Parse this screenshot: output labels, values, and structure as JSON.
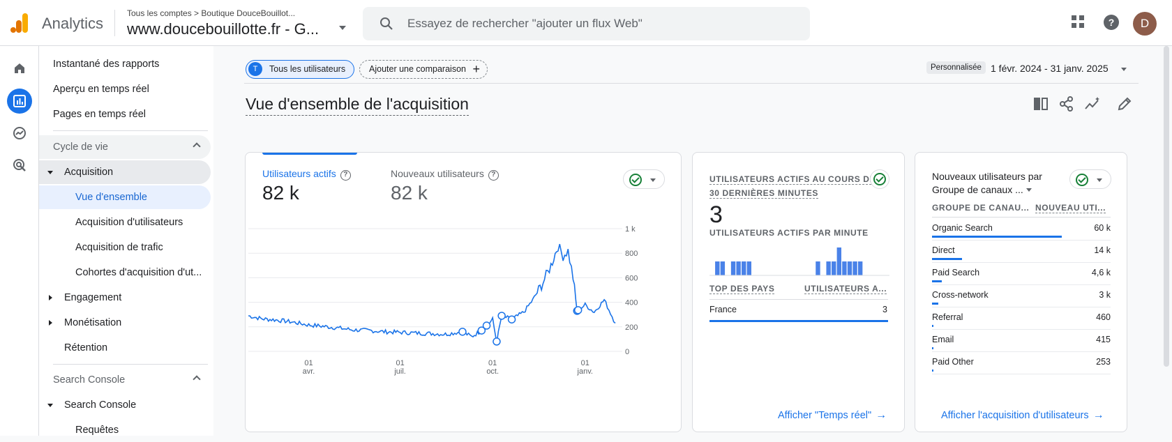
{
  "header": {
    "app_title": "Analytics",
    "breadcrumb": "Tous les comptes  >  Boutique DouceBouillot...",
    "property": "www.doucebouillotte.fr - G...",
    "search_placeholder": "Essayez de rechercher \"ajouter un flux Web\"",
    "avatar_letter": "D",
    "icons": [
      "apps-grid-icon",
      "help-icon"
    ]
  },
  "rail": {
    "icons": [
      "home-icon",
      "reports-icon",
      "explore-icon",
      "advertising-icon"
    ],
    "active": "reports-icon"
  },
  "nav": {
    "items": [
      {
        "label": "Instantané des rapports"
      },
      {
        "label": "Aperçu en temps réel"
      },
      {
        "label": "Pages en temps réel"
      },
      {
        "label": "Cycle de vie"
      },
      {
        "label": "Acquisition"
      },
      {
        "label": "Vue d'ensemble"
      },
      {
        "label": "Acquisition d'utilisateurs"
      },
      {
        "label": "Acquisition de trafic"
      },
      {
        "label": "Cohortes d'acquisition d'ut..."
      },
      {
        "label": "Engagement"
      },
      {
        "label": "Monétisation"
      },
      {
        "label": "Rétention"
      },
      {
        "label": "Search Console"
      },
      {
        "label": "Search Console"
      },
      {
        "label": "Requêtes"
      }
    ]
  },
  "toolbar": {
    "segment_chip": "Tous les utilisateurs",
    "segment_initial": "T",
    "compare_chip": "Ajouter une comparaison",
    "range_label": "Personnalisée",
    "range_value": "1 févr. 2024 - 31 janv. 2025",
    "page_title": "Vue d'ensemble de l'acquisition"
  },
  "card_users": {
    "tab1_label": "Utilisateurs actifs",
    "tab1_value": "82 k",
    "tab2_label": "Nouveaux utilisateurs",
    "tab2_value": "82 k",
    "y_ticks": [
      "1 k",
      "800",
      "600",
      "400",
      "200",
      "0"
    ],
    "x_ticks": [
      {
        "day": "01",
        "month": "avr."
      },
      {
        "day": "01",
        "month": "juil."
      },
      {
        "day": "01",
        "month": "oct."
      },
      {
        "day": "01",
        "month": "janv."
      }
    ]
  },
  "chart_data": {
    "type": "line",
    "x_range": [
      "2024-02-01",
      "2025-01-31"
    ],
    "ylim": [
      0,
      1000
    ],
    "series": [
      {
        "name": "Utilisateurs actifs",
        "points": [
          {
            "x": "2024-02-01",
            "y": 290
          },
          {
            "x": "2024-02-15",
            "y": 265
          },
          {
            "x": "2024-03-01",
            "y": 255
          },
          {
            "x": "2024-03-15",
            "y": 240
          },
          {
            "x": "2024-04-01",
            "y": 215
          },
          {
            "x": "2024-04-15",
            "y": 205
          },
          {
            "x": "2024-05-01",
            "y": 190
          },
          {
            "x": "2024-05-15",
            "y": 175
          },
          {
            "x": "2024-06-01",
            "y": 170
          },
          {
            "x": "2024-06-15",
            "y": 160
          },
          {
            "x": "2024-07-01",
            "y": 155
          },
          {
            "x": "2024-07-15",
            "y": 150
          },
          {
            "x": "2024-08-01",
            "y": 145
          },
          {
            "x": "2024-08-15",
            "y": 140
          },
          {
            "x": "2024-09-01",
            "y": 160
          },
          {
            "x": "2024-09-10",
            "y": 120
          },
          {
            "x": "2024-09-20",
            "y": 170
          },
          {
            "x": "2024-09-25",
            "y": 210
          },
          {
            "x": "2024-10-01",
            "y": 260
          },
          {
            "x": "2024-10-05",
            "y": 80
          },
          {
            "x": "2024-10-10",
            "y": 290
          },
          {
            "x": "2024-10-20",
            "y": 260
          },
          {
            "x": "2024-11-01",
            "y": 320
          },
          {
            "x": "2024-11-10",
            "y": 420
          },
          {
            "x": "2024-11-20",
            "y": 560
          },
          {
            "x": "2024-11-28",
            "y": 700
          },
          {
            "x": "2024-12-05",
            "y": 860
          },
          {
            "x": "2024-12-10",
            "y": 780
          },
          {
            "x": "2024-12-15",
            "y": 820
          },
          {
            "x": "2024-12-20",
            "y": 600
          },
          {
            "x": "2024-12-24",
            "y": 330
          },
          {
            "x": "2025-01-01",
            "y": 380
          },
          {
            "x": "2025-01-10",
            "y": 320
          },
          {
            "x": "2025-01-20",
            "y": 420
          },
          {
            "x": "2025-01-31",
            "y": 230
          }
        ],
        "annotations": [
          "2024-09-01",
          "2024-09-20",
          "2024-09-25",
          "2024-10-05",
          "2024-10-10",
          "2024-10-20",
          "2024-12-24",
          "2024-12-25"
        ]
      }
    ]
  },
  "card_realtime": {
    "title_line1": "UTILISATEURS ACTIFS AU COURS DES",
    "title_line2": "30 DERNIÈRES MINUTES",
    "value": "3",
    "per_minute_label": "UTILISATEURS ACTIFS PAR MINUTE",
    "per_minute": [
      0,
      1,
      1,
      0,
      1,
      1,
      1,
      1,
      0,
      0,
      0,
      0,
      0,
      0,
      0,
      0,
      0,
      0,
      0,
      0,
      1,
      0,
      1,
      1,
      2,
      1,
      1,
      1,
      1,
      0,
      0,
      0,
      0,
      0
    ],
    "col1": "TOP DES PAYS",
    "col2": "UTILISATEURS A...",
    "rows": [
      {
        "country": "France",
        "value": "3",
        "share": 1.0
      }
    ],
    "link": "Afficher \"Temps réel\""
  },
  "card_channels": {
    "title_line1": "Nouveaux utilisateurs par",
    "title_line2": "Groupe de canaux ...",
    "col1": "GROUPE DE CANAU...",
    "col2": "NOUVEAU UTI...",
    "rows": [
      {
        "name": "Organic Search",
        "value": "60 k",
        "share": 0.74
      },
      {
        "name": "Direct",
        "value": "14 k",
        "share": 0.17
      },
      {
        "name": "Paid Search",
        "value": "4,6 k",
        "share": 0.057
      },
      {
        "name": "Cross-network",
        "value": "3 k",
        "share": 0.037
      },
      {
        "name": "Referral",
        "value": "460",
        "share": 0.006
      },
      {
        "name": "Email",
        "value": "415",
        "share": 0.005
      },
      {
        "name": "Paid Other",
        "value": "253",
        "share": 0.003
      }
    ],
    "link": "Afficher l'acquisition d'utilisateurs"
  },
  "colors": {
    "accent": "#1a73e8",
    "success": "#188038",
    "text": "#202124",
    "muted": "#5f6368"
  }
}
